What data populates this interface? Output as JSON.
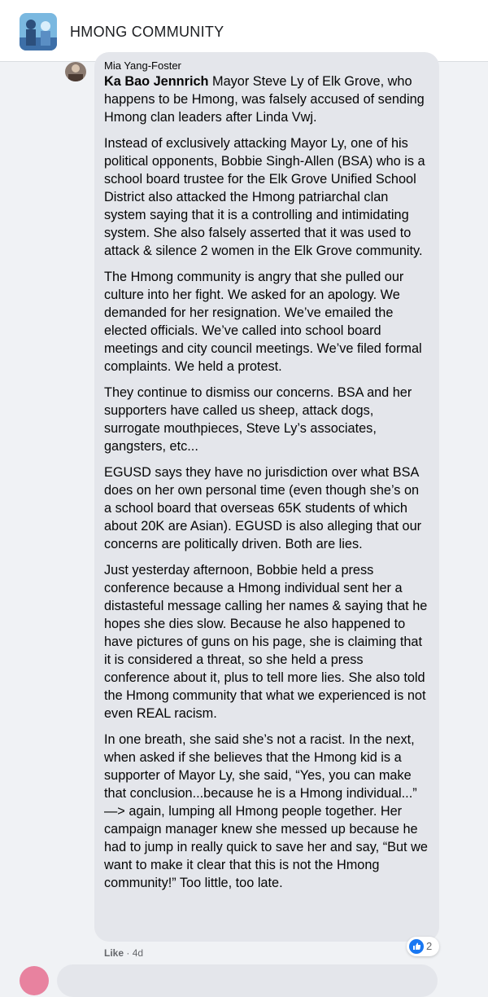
{
  "group": {
    "name": "HMONG COMMUNITY",
    "icon": "group-cover-image"
  },
  "comment": {
    "author": "Mia Yang-Foster",
    "mention": "Ka Bao Jennrich",
    "first_paragraph_rest": " Mayor Steve Ly of Elk Grove, who happens to be Hmong, was falsely accused of sending Hmong clan leaders after Linda Vwj.",
    "paragraphs": [
      "Instead of exclusively attacking Mayor Ly, one of his political opponents, Bobbie Singh-Allen (BSA) who is a school board trustee for the Elk Grove Unified School District also attacked the Hmong patriarchal clan system saying that it is a controlling and intimidating system. She also falsely asserted that it was used to attack & silence 2 women in the Elk Grove community.",
      "The Hmong community is angry that she pulled our culture into her fight. We asked for an apology. We demanded for her resignation. We’ve emailed the elected officials. We’ve called into school board meetings and city council meetings. We’ve filed formal complaints. We held a protest.",
      "They continue to dismiss our concerns. BSA and her supporters have called us sheep, attack dogs, surrogate mouthpieces, Steve Ly’s associates, gangsters, etc...",
      "EGUSD says they have no jurisdiction over what BSA does on her own personal time (even though she’s on a school board that overseas 65K students of which about 20K are Asian). EGUSD is also alleging that our concerns are politically driven. Both are lies.",
      "Just yesterday afternoon, Bobbie held a press conference because a Hmong individual sent her a distasteful message calling her names & saying that he hopes she dies slow. Because he also happened to have pictures of guns on his page, she is claiming that it is considered a threat, so she held a press conference about it, plus to tell more lies. She also told the Hmong community that what we experienced is not even REAL racism.",
      "In one breath, she said she’s not a racist. In the next, when asked if she believes that the Hmong kid is a supporter of Mayor Ly, she said, “Yes, you can make that conclusion...because he is a Hmong individual...” —> again, lumping all Hmong people together. Her campaign manager knew she messed up because he had to jump in really quick to save her and say, “But we want to make it clear that this is not the Hmong community!” Too little, too late."
    ],
    "like_label": "Like",
    "separator": "·",
    "time": "4d",
    "reaction_count": "2",
    "reaction_icon": "like-thumb-icon"
  },
  "colors": {
    "bubble": "#e4e6eb",
    "background": "#f0f2f5",
    "like_blue": "#1877f2"
  }
}
